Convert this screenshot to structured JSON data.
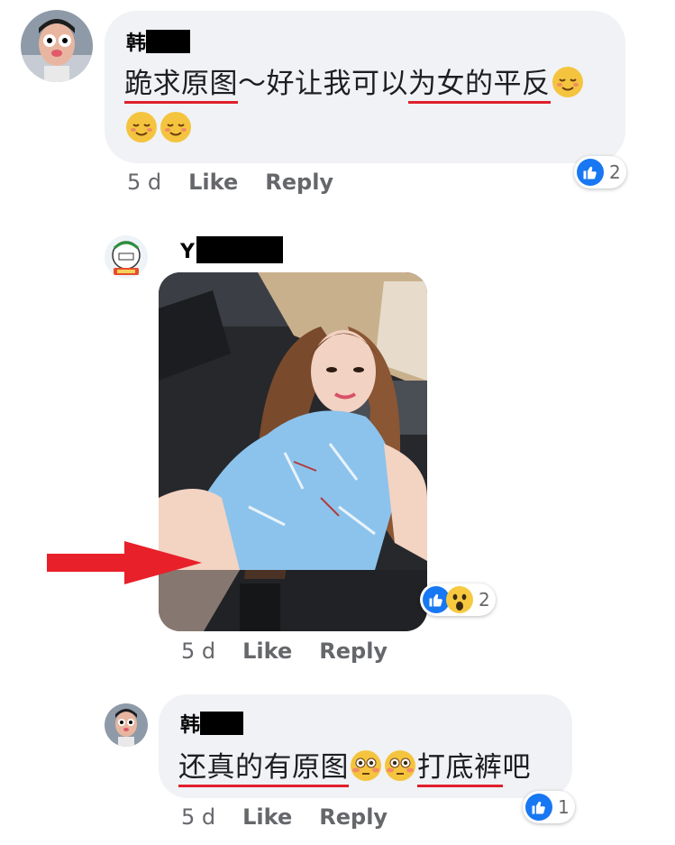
{
  "comments": [
    {
      "author": "韩",
      "text_parts": [
        {
          "t": "跪求原图",
          "u": true
        },
        {
          "t": "～好让我可以",
          "u": false
        },
        {
          "t": "为女的平反",
          "u": true
        }
      ],
      "time": "5 d",
      "like": "Like",
      "reply": "Reply",
      "reaction_count": "2"
    },
    {
      "author": "Y",
      "time": "5 d",
      "like": "Like",
      "reply": "Reply",
      "reaction_count": "2"
    },
    {
      "author": "韩",
      "text_parts": [
        {
          "t": "还真的有原图",
          "u": true
        },
        {
          "t": "打底裤",
          "u": true
        },
        {
          "t": "吧",
          "u": false
        }
      ],
      "time": "5 d",
      "like": "Like",
      "reply": "Reply",
      "reaction_count": "1"
    }
  ],
  "colors": {
    "accent": "#1877f2",
    "underline": "#e0202b",
    "arrow": "#e8202a",
    "bubble": "#f0f2f5"
  }
}
